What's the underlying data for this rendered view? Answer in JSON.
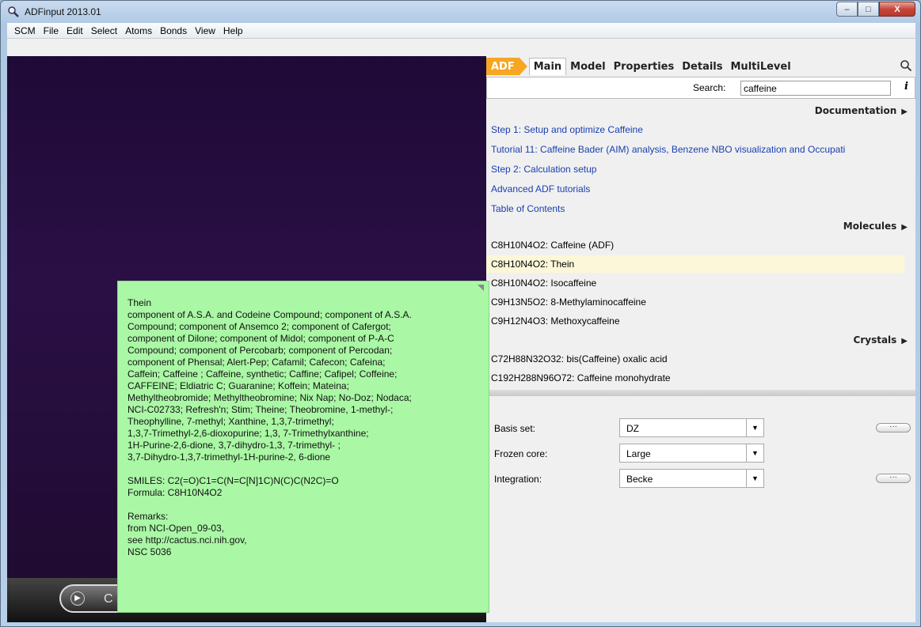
{
  "window": {
    "title": "ADFinput 2013.01",
    "min_label": "–",
    "max_label": "□",
    "close_label": "X"
  },
  "menu": [
    {
      "label": "SCM"
    },
    {
      "label": "File"
    },
    {
      "label": "Edit"
    },
    {
      "label": "Select"
    },
    {
      "label": "Atoms"
    },
    {
      "label": "Bonds"
    },
    {
      "label": "View"
    },
    {
      "label": "Help"
    }
  ],
  "tabs": {
    "adf": "ADF",
    "main": "Main",
    "model": "Model",
    "properties": "Properties",
    "details": "Details",
    "multilevel": "MultiLevel"
  },
  "search": {
    "label": "Search:",
    "value": "caffeine"
  },
  "sections": {
    "documentation": "Documentation",
    "molecules": "Molecules",
    "crystals": "Crystals"
  },
  "documentation_links": [
    "Step 1: Setup and optimize Caffeine",
    "Tutorial 11: Caffeine Bader (AIM) analysis, Benzene NBO visualization and Occupati",
    "Step 2: Calculation setup",
    "Advanced ADF tutorials",
    "Table of Contents"
  ],
  "molecules": [
    "C8H10N4O2: Caffeine (ADF)",
    "C8H10N4O2: Thein",
    "C8H10N4O2: Isocaffeine",
    "C9H13N5O2: 8-Methylaminocaffeine",
    "C9H12N4O3: Methoxycaffeine"
  ],
  "crystals": [
    "C72H88N32O32: bis(Caffeine) oxalic acid",
    "C192H288N96O72: Caffeine monohydrate"
  ],
  "params": {
    "basis_label": "Basis set:",
    "basis_value": "DZ",
    "frozen_label": "Frozen core:",
    "frozen_value": "Large",
    "integration_label": "Integration:",
    "integration_value": "Becke",
    "dots": "···"
  },
  "viewport": {
    "pill_text": "C"
  },
  "tooltip": {
    "text": "Thein\ncomponent of A.S.A. and Codeine Compound; component of A.S.A.\nCompound; component of Ansemco 2; component of Cafergot;\ncomponent of Dilone; component of Midol; component of P-A-C\nCompound; component of Percobarb; component of Percodan;\ncomponent of Phensal; Alert-Pep; Cafamil; Cafecon; Cafeina;\nCaffein; Caffeine ; Caffeine, synthetic; Caffine; Cafipel; Coffeine;\nCAFFEINE; Eldiatric C; Guaranine; Koffein; Mateina;\nMethyltheobromide; Methyltheobromine; Nix Nap; No-Doz; Nodaca;\nNCI-C02733; Refresh'n; Stim; Theine; Theobromine, 1-methyl-;\nTheophylline, 7-methyl; Xanthine, 1,3,7-trimethyl;\n1,3,7-Trimethyl-2,6-dioxopurine; 1,3, 7-Trimethylxanthine;\n1H-Purine-2,6-dione, 3,7-dihydro-1,3, 7-trimethyl- ;\n3,7-Dihydro-1,3,7-trimethyl-1H-purine-2, 6-dione\n\nSMILES:  C2(=O)C1=C(N=C[N]1C)N(C)C(N2C)=O\nFormula:  C8H10N4O2\n\nRemarks:\n              from NCI-Open_09-03,\n              see http://cactus.nci.nih.gov,\n              NSC 5036"
  }
}
